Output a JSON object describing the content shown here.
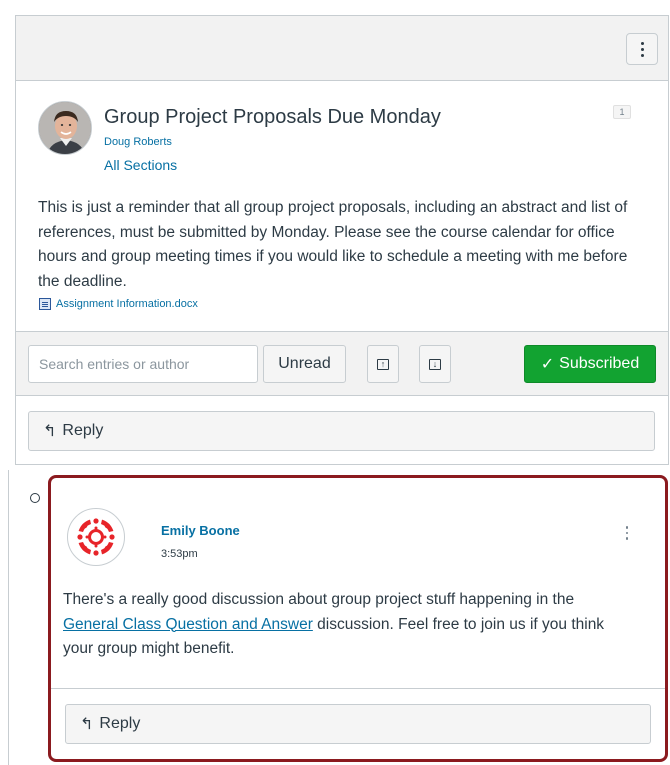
{
  "topic": {
    "title": "Group Project Proposals Due Monday",
    "author": "Doug Roberts",
    "sections": "All Sections",
    "unread_count": "1",
    "body": "This is just a reminder that all group project proposals, including an abstract and list of references, must be submitted by Monday. Please see the course calendar for office hours and group meeting times if you would like to schedule a meeting with me before the deadline.",
    "attachment": "Assignment Information.docx"
  },
  "toolbar": {
    "search_placeholder": "Search entries or author",
    "unread_label": "Unread",
    "subscribed_label": "Subscribed",
    "reply_label": "Reply"
  },
  "entry": {
    "author": "Emily Boone",
    "time": "3:53pm",
    "body_before_link": "There's a really good discussion about group project stuff happening in the ",
    "link_text": "General Class Question and Answer",
    "body_after_link": " discussion. Feel free to join us if you think your group might benefit.",
    "reply_label": "Reply"
  },
  "icons": {
    "options": "kebab-menu-icon",
    "attachment": "word-document-icon",
    "expand": "expand-all-icon",
    "collapse": "collapse-all-icon",
    "subscribed": "checkmark-icon",
    "reply": "reply-arrow-icon",
    "unread": "unread-indicator-icon"
  },
  "colors": {
    "link": "#0770a3",
    "subscribed_bg": "#12a331",
    "highlight_border": "#8b1a1f",
    "canvas_red": "#e72429"
  }
}
